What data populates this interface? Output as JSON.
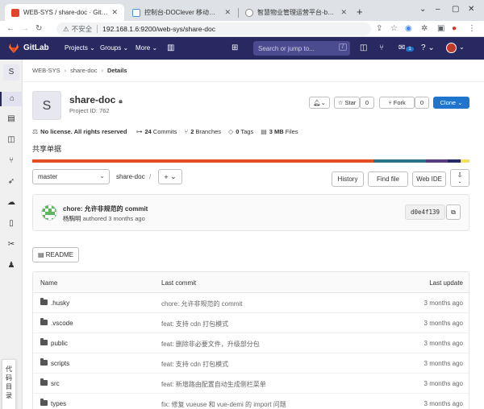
{
  "browser": {
    "tabs": [
      {
        "title": "WEB-SYS / share-doc · GitLab",
        "active": true,
        "icon_color": "#e24329"
      },
      {
        "title": "控制台-DOClever 移动时代最流行",
        "active": false,
        "icon_color": "#4a90d9"
      },
      {
        "title": "智慧物业管理运营平台-beta测试",
        "active": false,
        "icon_color": "#888888"
      }
    ],
    "new_tab": "+",
    "window_controls": [
      "⌄",
      "–",
      "▢",
      "✕"
    ],
    "insecure_label": "不安全",
    "url": "192.168.1.6:9200/web-sys/share-doc"
  },
  "header": {
    "brand": "GitLab",
    "nav": [
      "Projects",
      "Groups",
      "More"
    ],
    "search_placeholder": "Search or jump to...",
    "search_shortcut": "/",
    "mr_count": "1"
  },
  "sidebar": {
    "project_letter": "S",
    "code_dir": [
      "代",
      "码",
      "目",
      "录"
    ]
  },
  "breadcrumb": [
    "WEB-SYS",
    "share-doc",
    "Details"
  ],
  "project": {
    "avatar_letter": "S",
    "name": "share-doc",
    "id_text": "Project ID: 762",
    "star_label": "Star",
    "star_count": "0",
    "fork_label": "Fork",
    "fork_count": "0",
    "clone_label": "Clone",
    "description": "共享单据"
  },
  "stats": {
    "license": "No license. All rights reserved",
    "commits_num": "24",
    "commits_label": "Commits",
    "branches_num": "2",
    "branches_label": "Branches",
    "tags_num": "0",
    "tags_label": "Tags",
    "files_num": "3 MB",
    "files_label": "Files"
  },
  "languages": [
    {
      "color": "#e44d26",
      "share": 78
    },
    {
      "color": "#2b7489",
      "share": 12
    },
    {
      "color": "#563d7c",
      "share": 5
    },
    {
      "color": "#292961",
      "share": 3
    },
    {
      "color": "#f1e05a",
      "share": 2
    }
  ],
  "toolbar": {
    "branch": "master",
    "path": "share-doc",
    "path_sep": "/",
    "add": "+",
    "history": "History",
    "find_file": "Find file",
    "web_ide": "Web IDE"
  },
  "last_commit": {
    "title": "chore: 允许非规范的 commit",
    "author": "杨騊明",
    "authored": "authored",
    "time": "3 months ago",
    "sha": "d0e4f139"
  },
  "readme_label": "README",
  "tree": {
    "headers": {
      "name": "Name",
      "commit": "Last commit",
      "update": "Last update"
    },
    "rows": [
      {
        "name": ".husky",
        "commit": "chore: 允许非规范的 commit",
        "date": "3 months ago"
      },
      {
        "name": ".vscode",
        "commit": "feat: 支持 cdn 打包模式",
        "date": "3 months ago"
      },
      {
        "name": "public",
        "commit": "feat: 删除非必要文件，升级部分包",
        "date": "3 months ago"
      },
      {
        "name": "scripts",
        "commit": "feat: 支持 cdn 打包模式",
        "date": "3 months ago"
      },
      {
        "name": "src",
        "commit": "feat: 新增路由配置自动生成侧栏菜单",
        "date": "3 months ago"
      },
      {
        "name": "types",
        "commit": "fix: 修复 vueuse 和 vue-demi 的 import 问题",
        "date": "3 months ago"
      }
    ]
  }
}
